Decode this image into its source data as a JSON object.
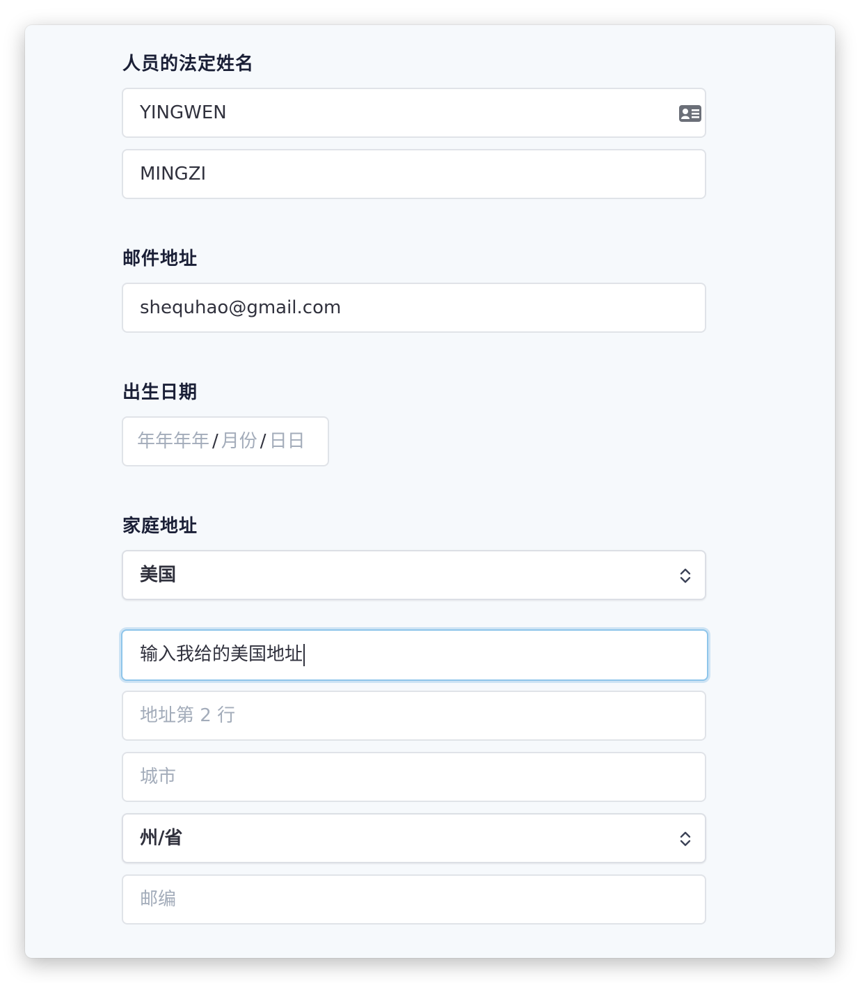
{
  "legal_name": {
    "label": "人员的法定姓名",
    "first_name_value": "YINGWEN",
    "last_name_value": "MINGZI"
  },
  "email": {
    "label": "邮件地址",
    "value": "shequhao@gmail.com"
  },
  "birth_date": {
    "label": "出生日期",
    "year_placeholder": "年年年年",
    "month_placeholder": "月份",
    "day_placeholder": "日日",
    "separator": "/"
  },
  "home_address": {
    "label": "家庭地址",
    "country_value": "美国",
    "line1_value": "输入我给的美国地址",
    "line2_placeholder": "地址第 2 行",
    "city_placeholder": "城市",
    "state_value": "州/省",
    "postal_placeholder": "邮编"
  },
  "colors": {
    "background": "#f6f9fc",
    "focus_ring": "#8ec5ea",
    "text": "#30313d",
    "placeholder": "#a3acba"
  },
  "icons": {
    "name_field": "id-card-icon",
    "select": "chevron-up-down-icon"
  }
}
